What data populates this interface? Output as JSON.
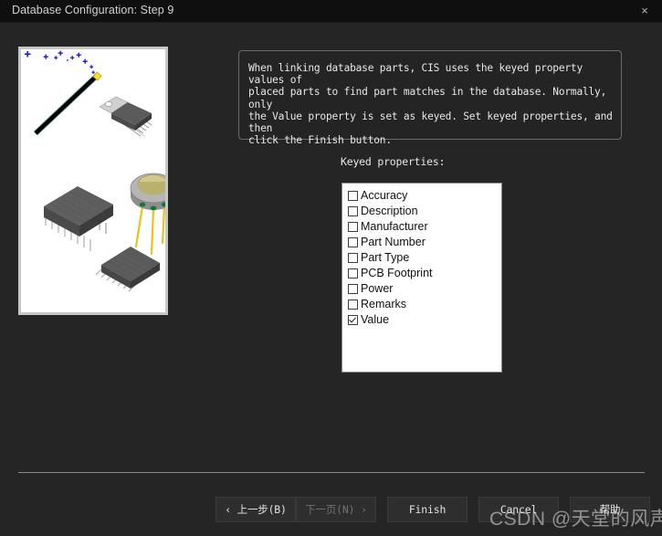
{
  "window": {
    "title": "Database Configuration: Step 9",
    "close_icon": "close-icon",
    "close_glyph": "×",
    "background_color": "#252525",
    "titlebar_color": "#0f0f0f"
  },
  "illustration": {
    "alt": "wizard-illustration-electronic-components",
    "elements": [
      "magic-wand",
      "sparkles",
      "to220-transistor",
      "dip-integrated-circuit",
      "to5-can-transistor",
      "tssop-integrated-circuit"
    ],
    "colors": {
      "sparkle": "#1a1ad0",
      "wand": "#000000",
      "wand_tip": "#f5e027",
      "package_dark": "#4a4a4a",
      "package_metal": "#b8b8b8",
      "can_top": "#cfc98a",
      "lead_gold": "#e8c317",
      "lead_green": "#0d7a2e"
    }
  },
  "description": {
    "text": "When linking database parts, CIS uses the keyed property values of\nplaced parts to find part matches in the database. Normally, only\nthe Value property is set as keyed. Set keyed properties, and then\nclick the Finish button."
  },
  "keyed_properties": {
    "label": "Keyed properties:",
    "items": [
      {
        "label": "Accuracy",
        "checked": false
      },
      {
        "label": "Description",
        "checked": false
      },
      {
        "label": "Manufacturer",
        "checked": false
      },
      {
        "label": "Part Number",
        "checked": false
      },
      {
        "label": "Part Type",
        "checked": false
      },
      {
        "label": "PCB Footprint",
        "checked": false
      },
      {
        "label": "Power",
        "checked": false
      },
      {
        "label": "Remarks",
        "checked": false
      },
      {
        "label": "Value",
        "checked": true
      }
    ]
  },
  "buttons": {
    "back": {
      "label": "‹ 上一步(B)",
      "disabled": false
    },
    "next": {
      "label": "下一页(N) ›",
      "disabled": true
    },
    "finish": {
      "label": "Finish",
      "disabled": false
    },
    "cancel": {
      "label": "Cancel",
      "disabled": false
    },
    "help": {
      "label": "帮助",
      "disabled": false
    }
  },
  "watermark": {
    "text": "CSDN @天堂的风声"
  }
}
